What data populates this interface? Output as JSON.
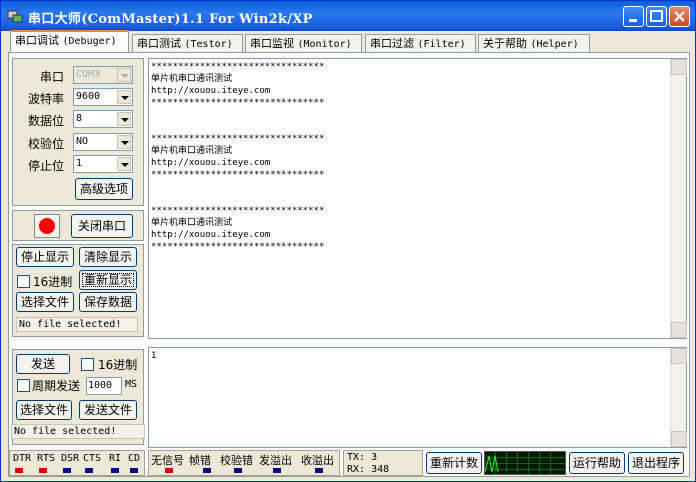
{
  "window": {
    "title": "串口大师(ComMaster)1.1 For Win2k/XP"
  },
  "tabs": [
    {
      "cn": "串口调试",
      "en": "(Debuger)"
    },
    {
      "cn": "串口测试",
      "en": "(Testor)"
    },
    {
      "cn": "串口监视",
      "en": "(Monitor)"
    },
    {
      "cn": "串口过滤",
      "en": "(Filter)"
    },
    {
      "cn": "关于帮助",
      "en": "(Helper)"
    }
  ],
  "settings": {
    "port_label": "串口",
    "port_value": "COM3",
    "baud_label": "波特率",
    "baud_value": "9600",
    "data_label": "数据位",
    "data_value": "8",
    "parity_label": "校验位",
    "parity_value": "NO",
    "stop_label": "停止位",
    "stop_value": "1",
    "advanced_button": "高级选项"
  },
  "port_control": {
    "close_button": "关闭串口",
    "indicator_color": "#ff0000"
  },
  "receive": {
    "stop_display": "停止显示",
    "clear_display": "清除显示",
    "hex_label": "16进制",
    "redisplay": "重新显示",
    "choose_file": "选择文件",
    "save_data": "保存数据",
    "file_status": "No file selected!",
    "text": "********************************\n单片机串口通讯测试\nhttp://xouou.iteye.com\n********************************\n\n\n********************************\n单片机串口通讯测试\nhttp://xouou.iteye.com\n********************************\n\n\n********************************\n单片机串口通讯测试\nhttp://xouou.iteye.com\n********************************"
  },
  "send": {
    "send_button": "发送",
    "hex_label": "16进制",
    "periodic_label": "周期发送",
    "period_value": "1000",
    "period_unit": "MS",
    "choose_file": "选择文件",
    "send_file": "发送文件",
    "file_status": "No file selected!",
    "text": "1"
  },
  "status": {
    "lines": [
      "DTR",
      "RTS",
      "DSR",
      "CTS",
      "RI",
      "CD"
    ],
    "line_colors": [
      "#e00000",
      "#e00000",
      "#000080",
      "#000080",
      "#000080",
      "#000080"
    ],
    "errors": [
      "无信号",
      "帧错",
      "校验错",
      "发溢出",
      "收溢出"
    ],
    "error_colors": [
      "#e00000",
      "#000080",
      "#000080",
      "#000080",
      "#000080"
    ],
    "tx": "TX: 3",
    "rx": "RX: 348",
    "reset_count": "重新计数",
    "run_help": "运行帮助",
    "exit": "退出程序"
  }
}
